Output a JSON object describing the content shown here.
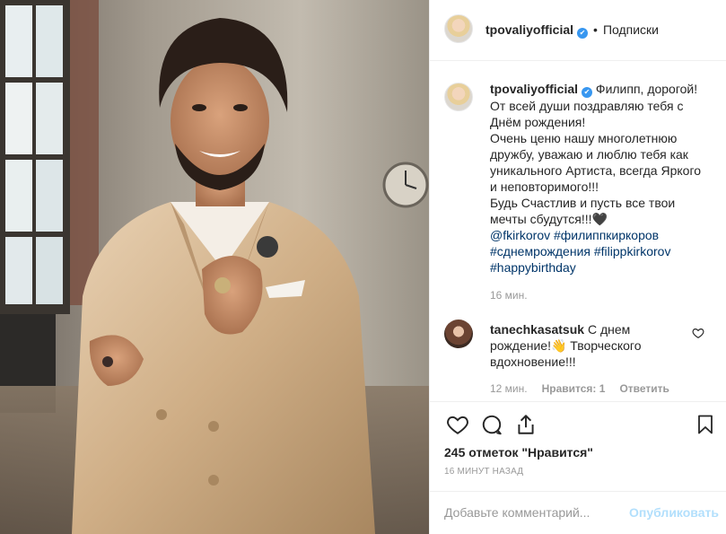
{
  "header": {
    "username": "tpovaliyofficial",
    "verified_mark": "✔",
    "separator": "•",
    "follow_label": "Подписки"
  },
  "caption": {
    "username": "tpovaliyofficial",
    "lines": [
      "Филипп, дорогой!",
      "От всей души поздравляю тебя с",
      "Днём рождения!",
      "Очень ценю нашу многолетнюю",
      "дружбу, уважаю и люблю тебя как",
      "уникального Артиста, всегда Яркого",
      "и неповторимого!!!",
      "Будь Счастлив и пусть все твои",
      "мечты сбудутся!!!🖤"
    ],
    "hashtags": [
      [
        "@fkirkorov",
        "#филиппкиркоров"
      ],
      [
        "#сднемрождения",
        "#filippkirkorov"
      ],
      [
        "#happybirthday"
      ]
    ],
    "time": "16 мин."
  },
  "comment": {
    "username": "tanechkasatsuk",
    "text_line1": "С днем",
    "text_line2": "рождение!👋 Творческого",
    "text_line3": "вдохновение!!!",
    "time": "12 мин.",
    "likes": "Нравится: 1",
    "reply": "Ответить"
  },
  "actions": {
    "likes_text": "245 отметок \"Нравится\"",
    "post_time": "16 МИНУТ НАЗАД"
  },
  "add_comment": {
    "placeholder": "Добавьте комментарий...",
    "publish_label": "Опубликовать"
  },
  "colors": {
    "link": "#003569",
    "verified": "#3897f0",
    "muted": "#999999",
    "publish_disabled": "#b2dffc"
  }
}
